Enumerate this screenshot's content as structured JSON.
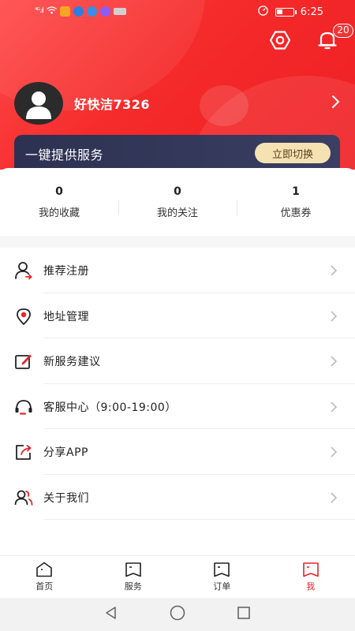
{
  "status_bar": {
    "signal": "⁴ᴳ.ıl",
    "time": "6:25",
    "battery_level": 0.35,
    "colors": {
      "app1": "#f5a623",
      "app2": "#2f7de1",
      "app3": "#3a8ee6",
      "app4": "#8b5cf6",
      "app5": "#d0d0d0"
    }
  },
  "header": {
    "notification_count": "20",
    "username": "好快洁7326",
    "switch_card": {
      "text": "一键提供服务",
      "button_label": "立即切换"
    }
  },
  "stats": [
    {
      "count": "0",
      "label": "我的收藏"
    },
    {
      "count": "0",
      "label": "我的关注"
    },
    {
      "count": "1",
      "label": "优惠券"
    }
  ],
  "menu": [
    {
      "label": "推荐注册",
      "icon": "user-arrow-icon"
    },
    {
      "label": "地址管理",
      "icon": "location-icon"
    },
    {
      "label": "新服务建议",
      "icon": "edit-icon"
    },
    {
      "label": "客服中心（9:00-19:00）",
      "icon": "headset-icon"
    },
    {
      "label": "分享APP",
      "icon": "share-icon"
    },
    {
      "label": "关于我们",
      "icon": "users-icon"
    }
  ],
  "tabs": [
    {
      "label": "首页",
      "active": false
    },
    {
      "label": "服务",
      "active": false
    },
    {
      "label": "订单",
      "active": false
    },
    {
      "label": "我",
      "active": true
    }
  ],
  "colors": {
    "brand_red": "#ee1f24",
    "card_dark": "#2d3151",
    "switch_btn": "#f5e2b3",
    "active_tab": "#e8242c"
  }
}
